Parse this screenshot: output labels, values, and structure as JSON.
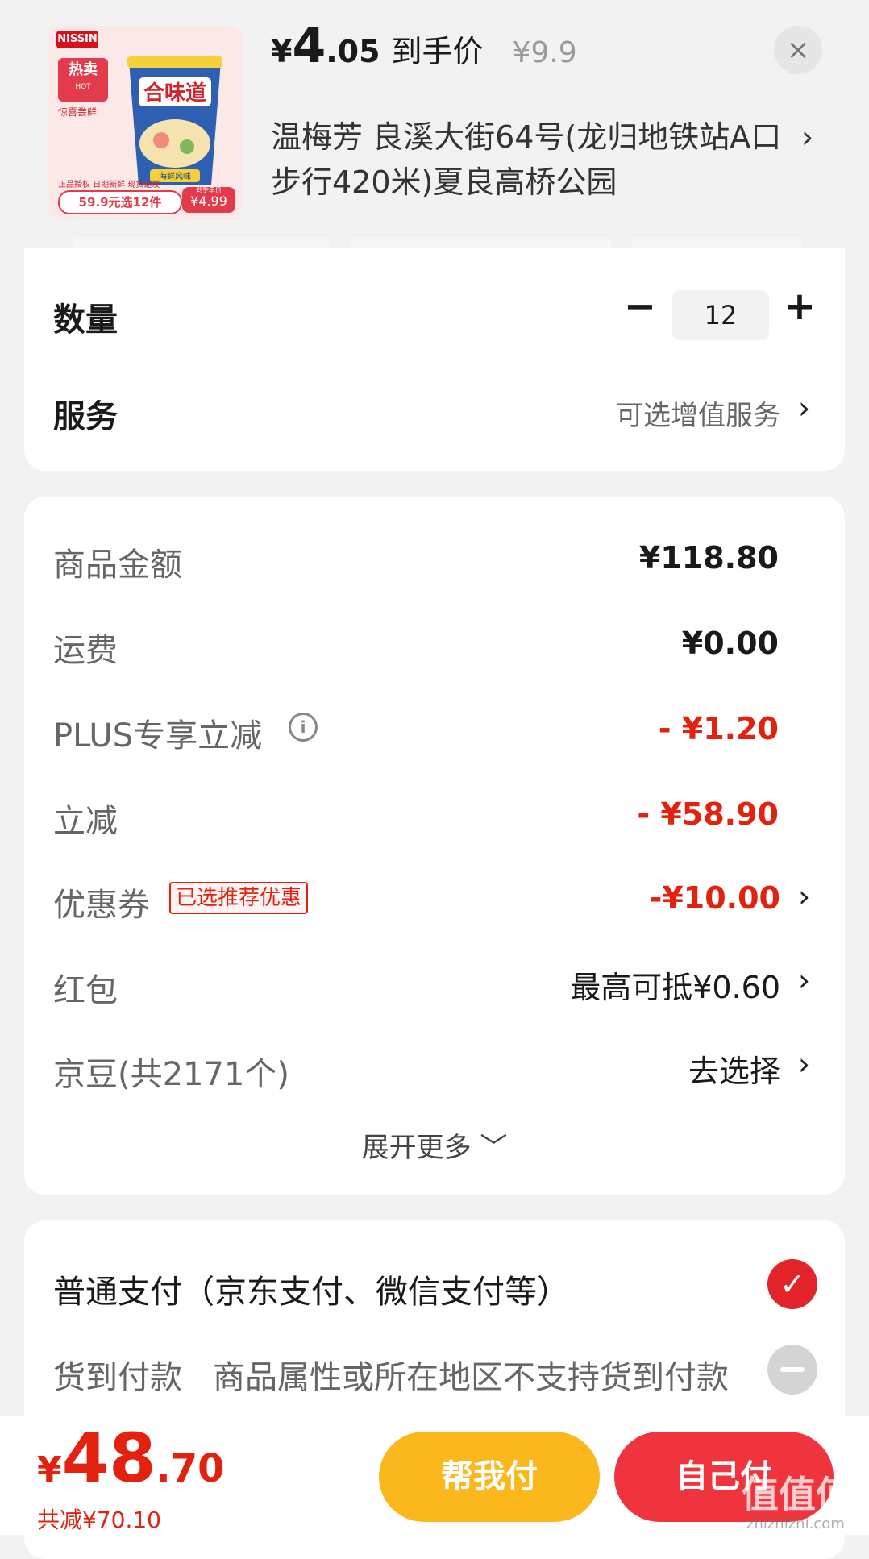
{
  "header": {
    "product_image": {
      "brand_logo": "NISSIN",
      "hot_badge": "热卖",
      "hot_badge_sub": "HOT",
      "hot_caption": "惊喜尝鲜",
      "cup_title": "合味道",
      "cup_flavor": "海鲜风味",
      "strip_text": "正品授权 日期新鲜 现货速发",
      "bundle_tag": "59.9元选12件",
      "unit_tag": "¥4.99",
      "unit_tag_sub": "到手单价"
    },
    "price": {
      "currency": "¥",
      "integer": "4",
      "decimal": ".05",
      "label": "到手价",
      "original": "¥9.9"
    },
    "close_icon": "×",
    "address": "温梅芳  良溪大街64号(龙归地铁站A口步行420米)夏良高桥公园",
    "address_chevron": "›"
  },
  "options": {
    "quantity_label": "数量",
    "quantity_value": "12",
    "minus": "−",
    "plus": "+",
    "service_label": "服务",
    "service_value": "可选增值服务",
    "chevron": "›"
  },
  "fees": {
    "rows": [
      {
        "label": "商品金额",
        "value": "¥118.80"
      },
      {
        "label": "运费",
        "value": "¥0.00"
      },
      {
        "label": "PLUS专享立减",
        "value": "- ¥1.20"
      },
      {
        "label": "立减",
        "value": "- ¥58.90"
      },
      {
        "label": "优惠券",
        "value": "-¥10.00"
      },
      {
        "label": "红包",
        "value": "最高可抵¥0.60"
      },
      {
        "label": "京豆(共2171个)",
        "value": "去选择"
      }
    ],
    "info_icon": "i",
    "coupon_badge": "已选推荐优惠",
    "expand": "展开更多 ﹀"
  },
  "payment": {
    "normal": "普通支付（京东支付、微信支付等）",
    "cod": "货到付款",
    "cod_note": "商品属性或所在地区不支持货到付款",
    "check": "✓"
  },
  "footer": {
    "total_currency": "¥",
    "total_integer": "48",
    "total_decimal": ".70",
    "saved": "共减¥70.10",
    "help_pay": "帮我付",
    "self_pay": "自己付",
    "watermark": "值值值",
    "watermark_sub": "zhizhizhi.com"
  },
  "colors": {
    "accent_red": "#e3210f",
    "help_button": "#fbb81c",
    "self_button": "#f0343d"
  }
}
